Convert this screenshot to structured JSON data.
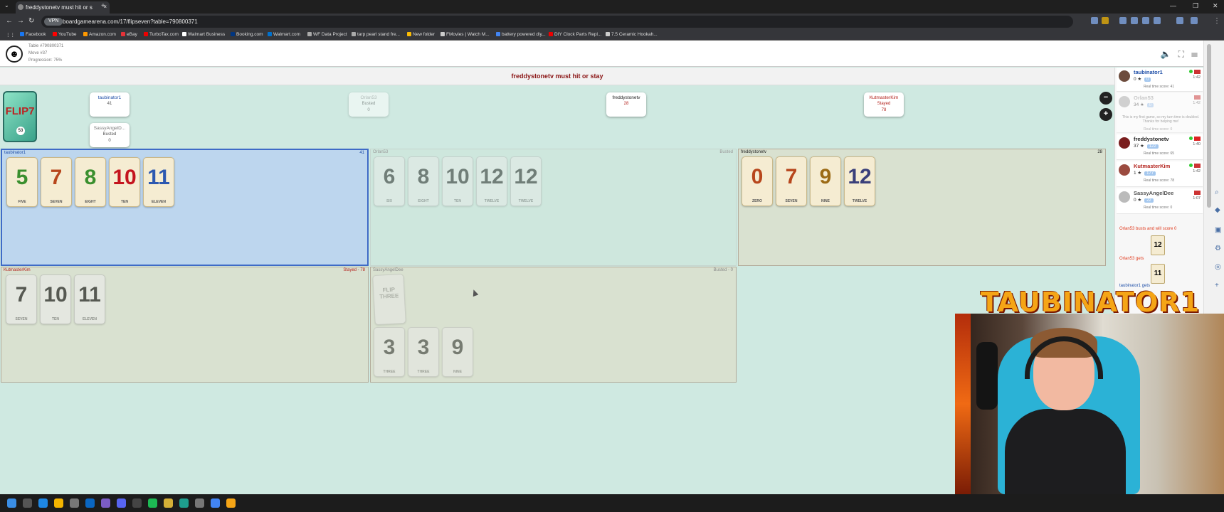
{
  "browser": {
    "tab_title": "freddystonetv must hit or s",
    "url": "boardgamearena.com/17/flipseven?table=790800371",
    "vpn_label": "VPN",
    "bookmarks": [
      "Facebook",
      "YouTube",
      "Amazon.com",
      "eBay",
      "TurboTax.com",
      "Walmart Business",
      "Booking.com",
      "Walmart.com",
      "WF Data Project",
      "tarp pearl stand fre...",
      "New folder",
      "FMovies | Watch M...",
      "battery powered diy...",
      "DIY Clock Parts Repl...",
      "7.5 Ceramic Hookah..."
    ]
  },
  "game_header": {
    "table_line": "Table #790800371",
    "move_line": "Move #37",
    "progress_line": "Progression: 75%"
  },
  "status": "freddystonetv must hit or stay",
  "deck": {
    "logo": "FLIP7",
    "count": "53"
  },
  "player_tags": [
    {
      "name": "taubinator1",
      "status": "",
      "score": "41",
      "color": "#1f4fa8"
    },
    {
      "name": "SassyAngelD...",
      "status": "Busted",
      "score": "0",
      "color": "#777"
    },
    {
      "name": "Orlan53",
      "status": "Busted",
      "score": "0",
      "color": "#999"
    },
    {
      "name": "freddystonetv",
      "status": "",
      "score": "28",
      "color": "#222"
    },
    {
      "name": "KutmasterKim",
      "status": "Stayed",
      "score": "78",
      "color": "#b3221c"
    }
  ],
  "areas": [
    {
      "name": "taubinator1",
      "status": "41",
      "name_color": "#1f4fa8",
      "cards": [
        {
          "v": "5",
          "w": "FIVE",
          "c": "#3a8f2e"
        },
        {
          "v": "7",
          "w": "SEVEN",
          "c": "#b7461c"
        },
        {
          "v": "8",
          "w": "EIGHT",
          "c": "#3a8f2e"
        },
        {
          "v": "10",
          "w": "TEN",
          "c": "#c4141e"
        },
        {
          "v": "11",
          "w": "ELEVEN",
          "c": "#2c58b0"
        }
      ]
    },
    {
      "name": "Orlan53",
      "status": "Busted",
      "name_color": "#999",
      "cards": [
        {
          "v": "6",
          "w": "SIX"
        },
        {
          "v": "8",
          "w": "EIGHT"
        },
        {
          "v": "10",
          "w": "TEN"
        },
        {
          "v": "12",
          "w": "TWELVE"
        },
        {
          "v": "12",
          "w": "TWELVE"
        }
      ]
    },
    {
      "name": "freddystonetv",
      "status": "28",
      "name_color": "#222",
      "cards": [
        {
          "v": "0",
          "w": "ZERO",
          "c": "#b7461c"
        },
        {
          "v": "7",
          "w": "SEVEN",
          "c": "#b7461c"
        },
        {
          "v": "9",
          "w": "NINE",
          "c": "#9c6b16"
        },
        {
          "v": "12",
          "w": "TWELVE",
          "c": "#3a3f7a"
        }
      ]
    },
    {
      "name": "KutmasterKim",
      "status": "Stayed - 78",
      "name_color": "#b3221c",
      "cards": [
        {
          "v": "7",
          "w": "SEVEN"
        },
        {
          "v": "10",
          "w": "TEN"
        },
        {
          "v": "11",
          "w": "ELEVEN"
        }
      ]
    },
    {
      "name": "SassyAngelDee",
      "status": "Busted - 0",
      "name_color": "#888",
      "action": "FLIP THREE",
      "cards": [
        {
          "v": "3",
          "w": "THREE"
        },
        {
          "v": "3",
          "w": "THREE"
        },
        {
          "v": "9",
          "w": "NINE"
        }
      ]
    }
  ],
  "panel": {
    "players": [
      {
        "name": "taubinator1",
        "pts": "0",
        "badge": "0",
        "time": "1:42",
        "rt": "Real time score: 41",
        "color": "#1f4fa8",
        "flag": "#c33"
      },
      {
        "name": "Orlan53",
        "pts": "34",
        "badge": "0",
        "time": "1:42",
        "rt": "",
        "color": "#999",
        "flag": "#c33",
        "msg": "This is my first game, so my turn time is doubled. Thanks for helping me!",
        "rt2": "Real time score: 0"
      },
      {
        "name": "freddystonetv",
        "pts": "37",
        "badge": "122",
        "time": "1:40",
        "rt": "Real time score: 65",
        "color": "#222",
        "flag": "#d22"
      },
      {
        "name": "KutmasterKim",
        "pts": "1",
        "badge": "177",
        "time": "1:42",
        "rt": "Real time score: 78",
        "color": "#b3221c",
        "flag": "#c33"
      },
      {
        "name": "SassyAngelDee",
        "pts": "0",
        "badge": "22",
        "time": "1:07",
        "rt": "Real time score: 0",
        "color": "#555",
        "flag": "#c33"
      }
    ],
    "log1": "Orlan53 busts and will score 0",
    "log_card1": "12",
    "log2": "Orlan53 gets",
    "log_card2": "11",
    "log3": "taubinator1 gets"
  },
  "webcam": {
    "overlay_name": "TAUBINATOR1"
  }
}
